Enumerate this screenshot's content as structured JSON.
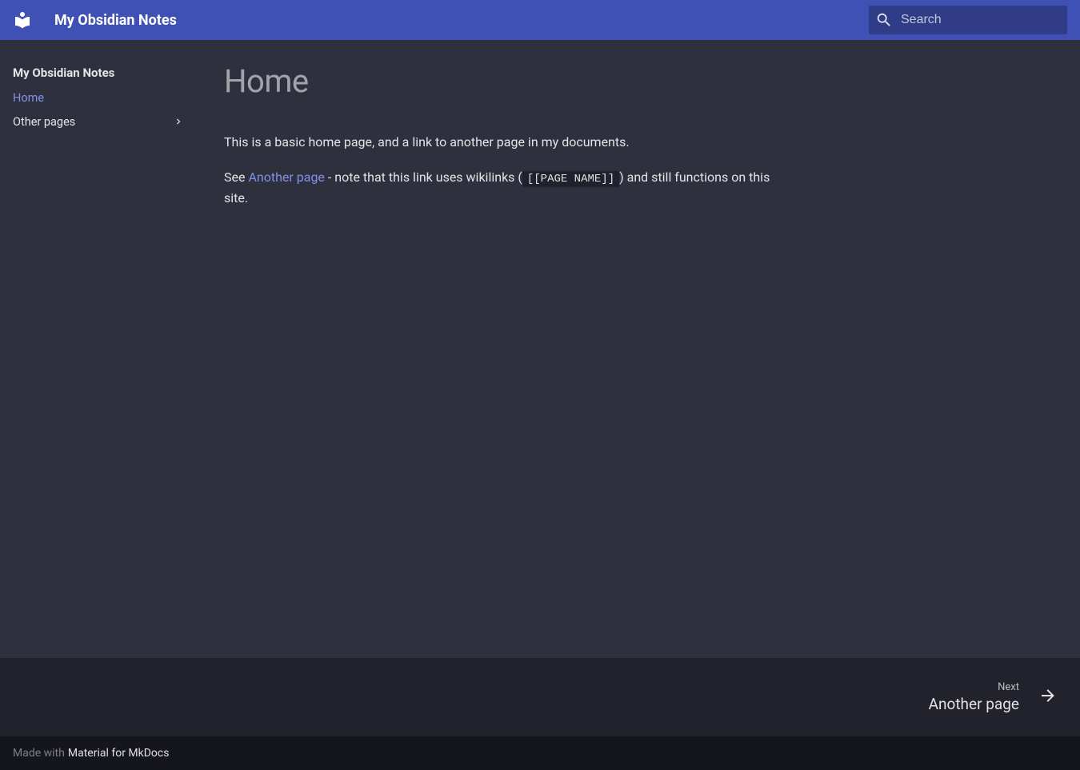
{
  "header": {
    "title": "My Obsidian Notes",
    "search_placeholder": "Search"
  },
  "sidebar": {
    "title": "My Obsidian Notes",
    "items": [
      {
        "label": "Home",
        "active": true,
        "expandable": false
      },
      {
        "label": "Other pages",
        "active": false,
        "expandable": true
      }
    ]
  },
  "content": {
    "heading": "Home",
    "para1": "This is a basic home page, and a link to another page in my documents.",
    "para2_prefix": "See ",
    "para2_link": "Another page",
    "para2_mid": " - note that this link uses wikilinks (",
    "para2_code": "[[PAGE NAME]]",
    "para2_suffix": ") and still functions on this site."
  },
  "footer_nav": {
    "next_label": "Next",
    "next_title": "Another page"
  },
  "footer_meta": {
    "made_prefix": "Made with",
    "made_link": "Material for MkDocs"
  }
}
